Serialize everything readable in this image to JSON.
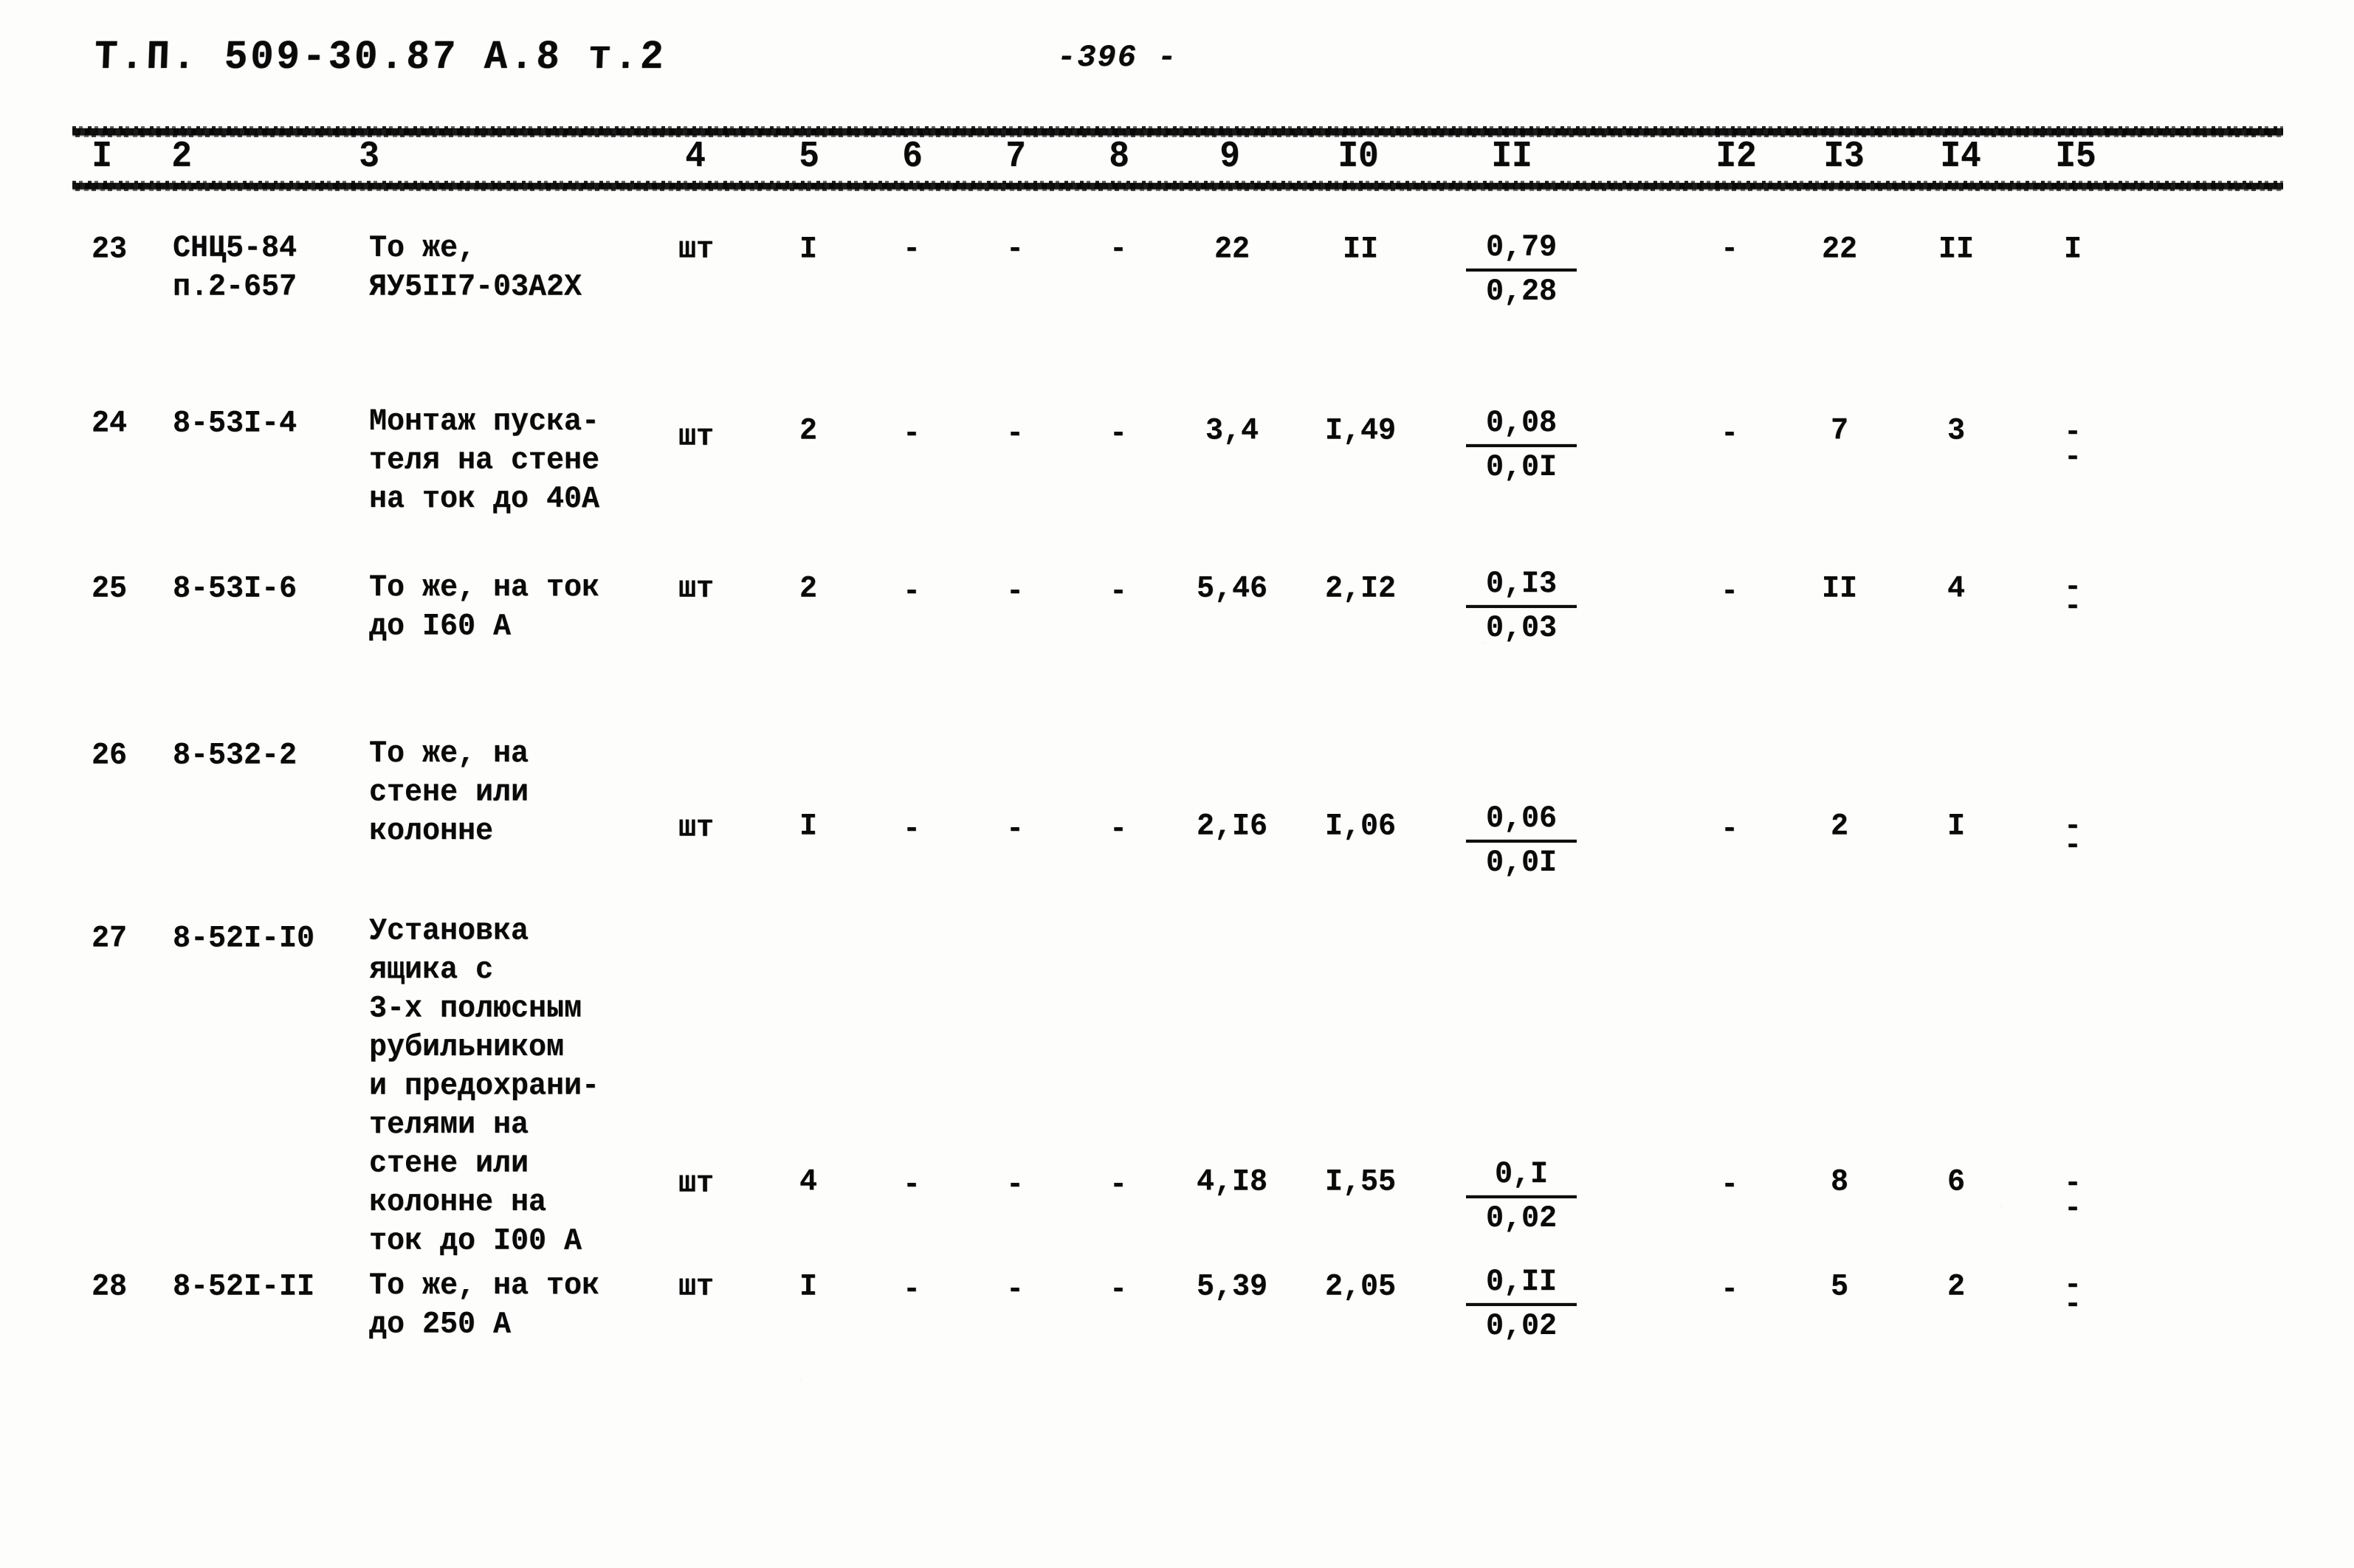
{
  "header": {
    "document_code": "Т.П. 509-30.87 А.8 т.2",
    "page_number": "-396 -"
  },
  "table": {
    "column_numbers": [
      "I",
      "2",
      "3",
      "4",
      "5",
      "6",
      "7",
      "8",
      "9",
      "I0",
      "II",
      "I2",
      "I3",
      "I4",
      "I5"
    ],
    "rows": [
      {
        "c1": "23",
        "c2": "СНЦ5-84\nп.2-657",
        "c3": "То же,\nЯУ5II7-03А2Х",
        "c4": "шт",
        "c5": "I",
        "c6": "-",
        "c7": "-",
        "c8": "-",
        "c9": "22",
        "c10": "II",
        "c11_num": "0,79",
        "c11_den": "0,28",
        "c12": "-",
        "c13": "22",
        "c14": "II",
        "c15": "I",
        "c15_type": "text"
      },
      {
        "c1": "24",
        "c2": "8-53I-4",
        "c3": "Монтаж пуска-\nтеля на стене\nна ток до 40А",
        "c4": "шт",
        "c5": "2",
        "c6": "-",
        "c7": "-",
        "c8": "-",
        "c9": "3,4",
        "c10": "I,49",
        "c11_num": "0,08",
        "c11_den": "0,0I",
        "c12": "-",
        "c13": "7",
        "c14": "3",
        "c15_top": "-",
        "c15_bot": "-",
        "c15_type": "dashpair"
      },
      {
        "c1": "25",
        "c2": "8-53I-6",
        "c3": "То же, на ток\nдо I60 А",
        "c4": "шт",
        "c5": "2",
        "c6": "-",
        "c7": "-",
        "c8": "-",
        "c9": "5,46",
        "c10": "2,I2",
        "c11_num": "0,I3",
        "c11_den": "0,03",
        "c12": "-",
        "c13": "II",
        "c14": "4",
        "c15_top": "-",
        "c15_bot": "-",
        "c15_type": "dashpair"
      },
      {
        "c1": "26",
        "c2": "8-532-2",
        "c3": "То же, на\nстене или\nколонне",
        "c4": "шт",
        "c5": "I",
        "c6": "-",
        "c7": "-",
        "c8": "-",
        "c9": "2,I6",
        "c10": "I,06",
        "c11_num": "0,06",
        "c11_den": "0,0I",
        "c12": "-",
        "c13": "2",
        "c14": "I",
        "c15_top": "-",
        "c15_bot": "-",
        "c15_type": "dashpair"
      },
      {
        "c1": "27",
        "c2": "8-52I-I0",
        "c3": "Установка\nящика с\n3-х полюсным\nрубильником\nи предохрани-\nтелями на\nстене или\nколонне на\nток до I00 А",
        "c4": "шт",
        "c5": "4",
        "c6": "-",
        "c7": "-",
        "c8": "-",
        "c9": "4,I8",
        "c10": "I,55",
        "c11_num": "0,I",
        "c11_den": "0,02",
        "c12": "-",
        "c13": "8",
        "c14": "6",
        "c15_top": "-",
        "c15_bot": "-",
        "c15_type": "dashpair"
      },
      {
        "c1": "28",
        "c2": "8-52I-II",
        "c3": "То же, на ток\nдо 250 А",
        "c4": "шт",
        "c5": "I",
        "c6": "-",
        "c7": "-",
        "c8": "-",
        "c9": "5,39",
        "c10": "2,05",
        "c11_num": "0,II",
        "c11_den": "0,02",
        "c12": "-",
        "c13": "5",
        "c14": "2",
        "c15_top": "-",
        "c15_bot": "-",
        "c15_type": "dashpair"
      }
    ]
  }
}
